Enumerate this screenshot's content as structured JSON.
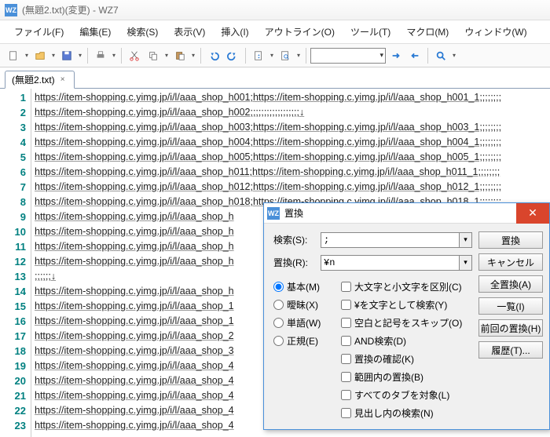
{
  "title": "(無題2.txt)(変更) - WZ7",
  "app_icon": "WZ",
  "menu": [
    "ファイル(F)",
    "編集(E)",
    "検索(S)",
    "表示(V)",
    "挿入(I)",
    "アウトライン(O)",
    "ツール(T)",
    "マクロ(M)",
    "ウィンドウ(W)"
  ],
  "tab": {
    "label": "(無題2.txt)"
  },
  "lines": [
    "https://item-shopping.c.yimg.jp/i/l/aaa_shop_h001;https://item-shopping.c.yimg.jp/i/l/aaa_shop_h001_1;;;;;;;;",
    "https://item-shopping.c.yimg.jp/i/l/aaa_shop_h002;;;;;;;;;;;;;;;;;;↓",
    "https://item-shopping.c.yimg.jp/i/l/aaa_shop_h003;https://item-shopping.c.yimg.jp/i/l/aaa_shop_h003_1;;;;;;;;",
    "https://item-shopping.c.yimg.jp/i/l/aaa_shop_h004;https://item-shopping.c.yimg.jp/i/l/aaa_shop_h004_1;;;;;;;;",
    "https://item-shopping.c.yimg.jp/i/l/aaa_shop_h005;https://item-shopping.c.yimg.jp/i/l/aaa_shop_h005_1;;;;;;;;",
    "https://item-shopping.c.yimg.jp/i/l/aaa_shop_h011;https://item-shopping.c.yimg.jp/i/l/aaa_shop_h011_1;;;;;;;;",
    "https://item-shopping.c.yimg.jp/i/l/aaa_shop_h012;https://item-shopping.c.yimg.jp/i/l/aaa_shop_h012_1;;;;;;;;",
    "https://item-shopping.c.yimg.jp/i/l/aaa_shop_h018;https://item-shopping.c.yimg.jp/i/l/aaa_shop_h018_1;;;;;;;;",
    "https://item-shopping.c.yimg.jp/i/l/aaa_shop_h",
    "https://item-shopping.c.yimg.jp/i/l/aaa_shop_h",
    "https://item-shopping.c.yimg.jp/i/l/aaa_shop_h",
    "https://item-shopping.c.yimg.jp/i/l/aaa_shop_h",
    ";;;;;;↓",
    "https://item-shopping.c.yimg.jp/i/l/aaa_shop_h",
    "https://item-shopping.c.yimg.jp/i/l/aaa_shop_1",
    "https://item-shopping.c.yimg.jp/i/l/aaa_shop_1",
    "https://item-shopping.c.yimg.jp/i/l/aaa_shop_2",
    "https://item-shopping.c.yimg.jp/i/l/aaa_shop_3",
    "https://item-shopping.c.yimg.jp/i/l/aaa_shop_4",
    "https://item-shopping.c.yimg.jp/i/l/aaa_shop_4",
    "https://item-shopping.c.yimg.jp/i/l/aaa_shop_4",
    "https://item-shopping.c.yimg.jp/i/l/aaa_shop_4",
    "https://item-shopping.c.yimg.jp/i/l/aaa_shop_4"
  ],
  "dlg": {
    "title": "置換",
    "search_label": "検索(S):",
    "search_value": ";",
    "replace_label": "置換(R):",
    "replace_value": "¥n",
    "radios": {
      "basic": "基本(M)",
      "aimai": "曖昧(X)",
      "word": "単語(W)",
      "regex": "正規(E)"
    },
    "checks": {
      "case": "大文字と小文字を区別(C)",
      "yen": "¥を文字として検索(Y)",
      "skip": "空白と記号をスキップ(O)",
      "and": "AND検索(D)",
      "confirm": "置換の確認(K)",
      "range": "範囲内の置換(B)",
      "tabs": "すべてのタブを対象(L)",
      "heading": "見出し内の検索(N)"
    },
    "btns": {
      "replace": "置換",
      "cancel": "キャンセル",
      "all": "全置換(A)",
      "list": "一覧(I)",
      "prev": "前回の置換(H)",
      "history": "履歴(T)..."
    }
  }
}
